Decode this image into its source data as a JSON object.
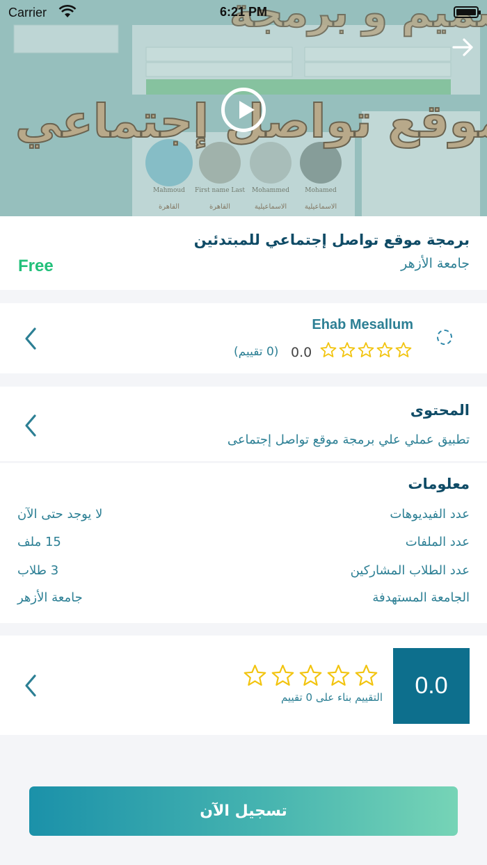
{
  "status_bar": {
    "carrier": "Carrier",
    "time": "6:21 PM"
  },
  "hero": {
    "title_line1": "تصميم و برمجة",
    "title_line2": "موقع تواصل إجتماعي",
    "preview_names": [
      "Mahmoud",
      "First name Last",
      "Mohammed",
      "Mohamed"
    ],
    "preview_cities": [
      "القاهرة",
      "القاهرة",
      "الاسماعيلية",
      "الاسماعيلية"
    ]
  },
  "course": {
    "title": "برمجة موقع تواصل إجتماعي للمبتدئين",
    "university": "جامعة الأزهر",
    "price": "Free"
  },
  "instructor": {
    "name": "Ehab Mesallum",
    "rating": 0.0,
    "rating_text": "0.0",
    "rating_count": "(0 تقييم)",
    "stars_total": 5
  },
  "content": {
    "heading": "المحتوى",
    "description": "تطبيق عملي علي برمجة موقع تواصل إجتماعى"
  },
  "info": {
    "heading": "معلومات",
    "rows": [
      {
        "label": "عدد الفيديوهات",
        "value": "لا يوجد حتى الآن"
      },
      {
        "label": "عدد الملفات",
        "value": "15 ملف"
      },
      {
        "label": "عدد الطلاب المشاركين",
        "value": "3 طلاب"
      },
      {
        "label": "الجامعة المستهدفة",
        "value": "جامعة الأزهر"
      }
    ]
  },
  "rating": {
    "score": "0.0",
    "note": "التقييم بناء على 0 تقييم",
    "stars_total": 5
  },
  "register_button": "تسجيل الآن",
  "colors": {
    "primary": "#0d6f8d",
    "accent_text": "#2c7f94",
    "price_green": "#22c07a",
    "star_gold": "#f2c40f"
  },
  "icons": [
    "wifi-icon",
    "battery-icon",
    "play-icon",
    "share-arrow-icon",
    "chevron-left-icon",
    "star-outline-icon",
    "spinner-icon"
  ]
}
